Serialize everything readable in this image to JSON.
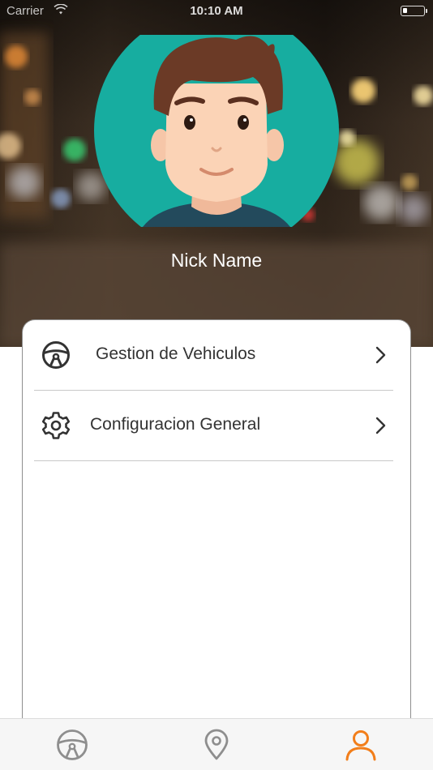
{
  "status_bar": {
    "carrier": "Carrier",
    "time": "10:10 AM",
    "wifi_icon": "wifi-icon",
    "battery_icon": "battery-icon",
    "battery_level": 0.1
  },
  "profile": {
    "avatar_icon": "avatar-illustration",
    "nick_name": "Nick Name",
    "avatar_bg_color": "#17ADA0"
  },
  "menu": {
    "items": [
      {
        "label": "Gestion de Vehiculos",
        "icon": "steering-wheel-icon",
        "trailing_icon": "chevron-right-icon"
      },
      {
        "label": "Configuracion General",
        "icon": "gear-icon",
        "trailing_icon": "chevron-right-icon"
      }
    ]
  },
  "tab_bar": {
    "tabs": [
      {
        "icon": "steering-wheel-icon",
        "selected": false
      },
      {
        "icon": "location-pin-icon",
        "selected": false
      },
      {
        "icon": "user-icon",
        "selected": true
      }
    ],
    "active_color": "#F27E1A",
    "inactive_color": "#8E8E8E"
  },
  "colors": {
    "text_primary": "#333333",
    "divider": "#C8C8C8",
    "card_border": "#8F8F8F"
  }
}
